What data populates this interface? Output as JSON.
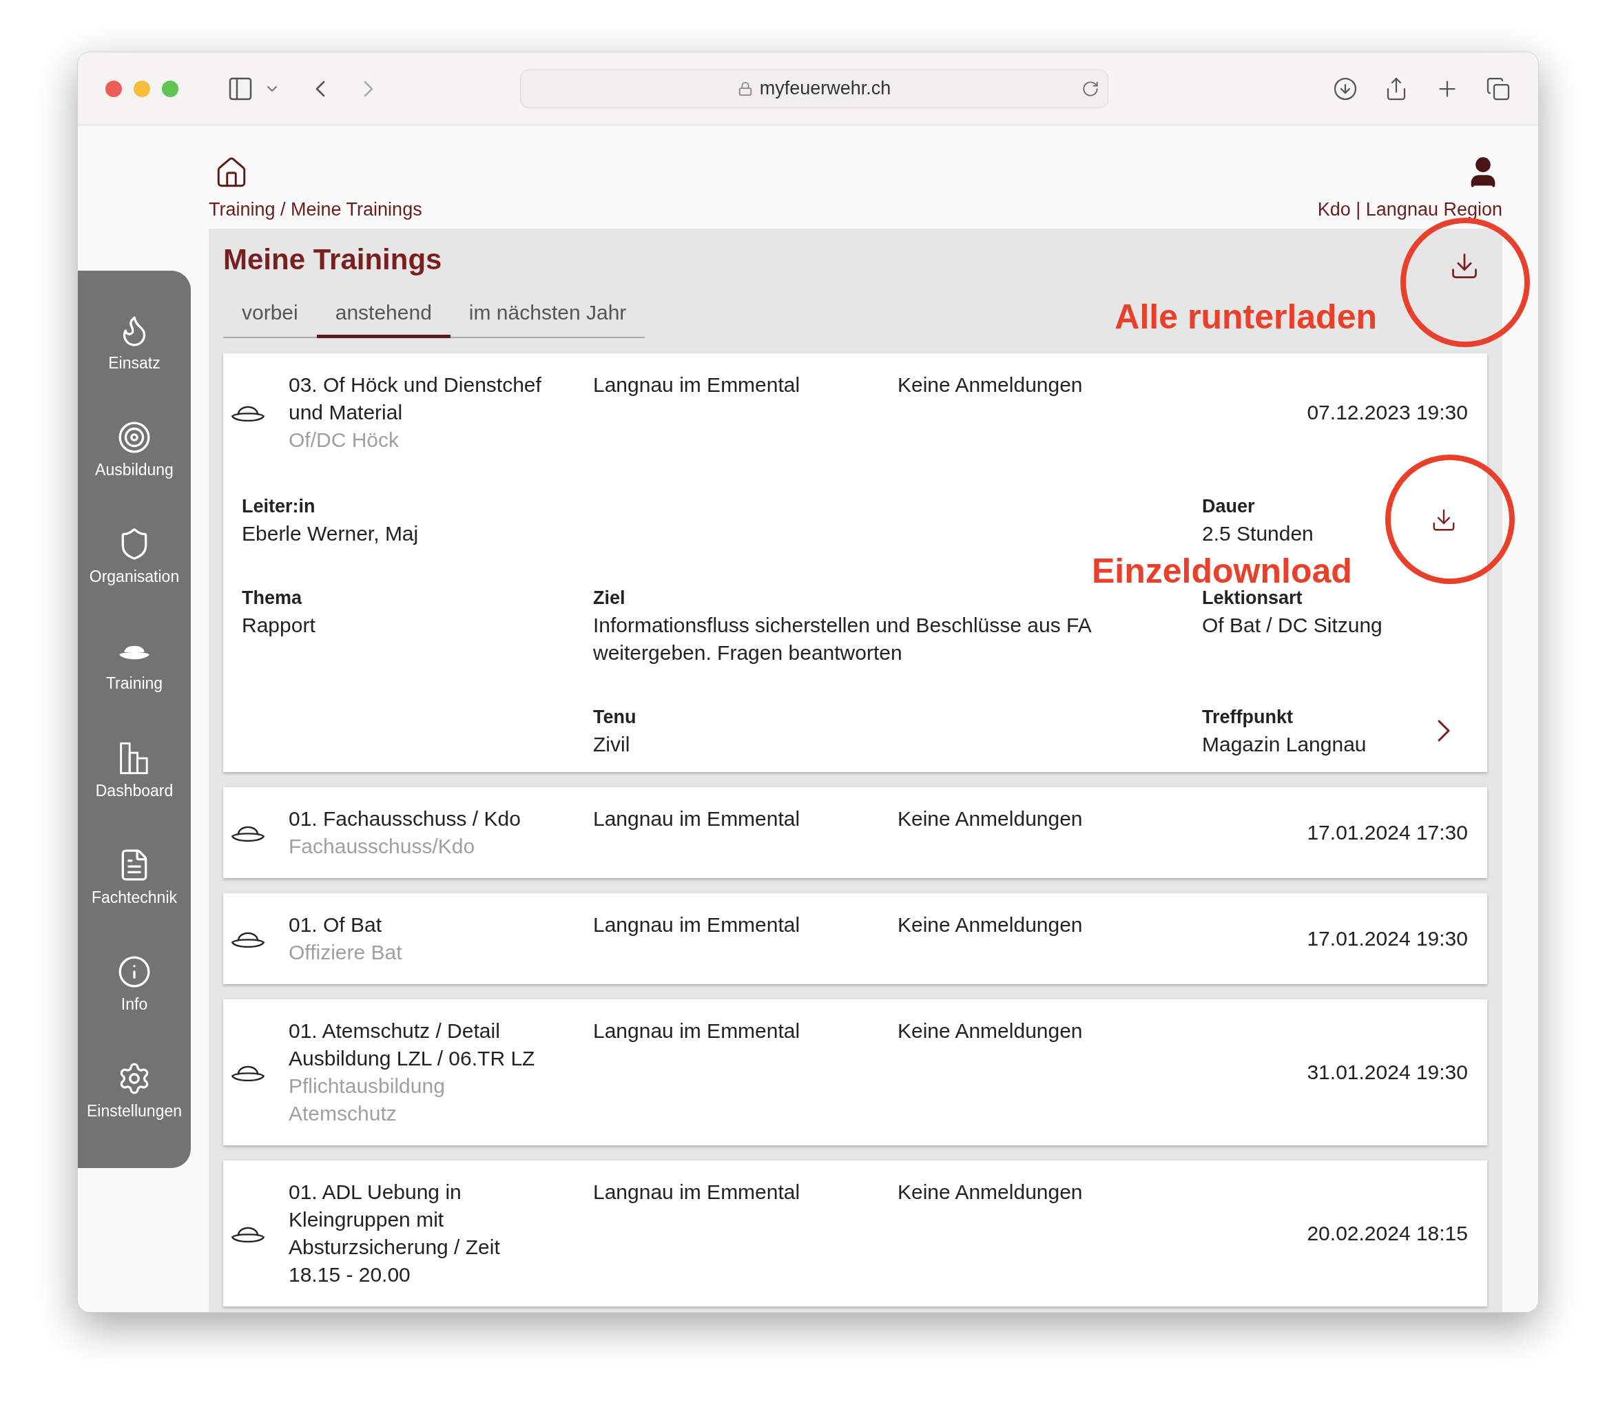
{
  "browser": {
    "url": "myfeuerwehr.ch"
  },
  "header": {
    "breadcrumb": "Training / Meine Trainings",
    "user": "Kdo | Langnau Region"
  },
  "sidebar": {
    "items": [
      {
        "label": "Einsatz"
      },
      {
        "label": "Ausbildung"
      },
      {
        "label": "Organisation"
      },
      {
        "label": "Training"
      },
      {
        "label": "Dashboard"
      },
      {
        "label": "Fachtechnik"
      },
      {
        "label": "Info"
      },
      {
        "label": "Einstellungen"
      }
    ]
  },
  "page": {
    "title": "Meine Trainings",
    "tabs": [
      {
        "label": "vorbei",
        "selected": false
      },
      {
        "label": "anstehend",
        "selected": true
      },
      {
        "label": "im nächsten Jahr",
        "selected": false
      }
    ],
    "annotations": {
      "download_all": "Alle runterladen",
      "single_download": "Einzeldownload"
    },
    "trainings": [
      {
        "title": "03. Of Höck und Dienstchef und Material",
        "subtitle": "Of/DC Höck",
        "location": "Langnau im Emmental",
        "registrations": "Keine Anmeldungen",
        "datetime": "07.12.2023 19:30",
        "details": {
          "leader_label": "Leiter:in",
          "leader": "Eberle Werner, Maj",
          "duration_label": "Dauer",
          "duration": "2.5 Stunden",
          "topic_label": "Thema",
          "topic": "Rapport",
          "goal_label": "Ziel",
          "goal": "Informationsfluss sicherstellen und Beschlüsse aus FA weitergeben. Fragen beantworten",
          "lesson_type_label": "Lektionsart",
          "lesson_type": "Of Bat / DC Sitzung",
          "dress_label": "Tenu",
          "dress": "Zivil",
          "meeting_label": "Treffpunkt",
          "meeting": "Magazin Langnau"
        }
      },
      {
        "title": "01. Fachausschuss / Kdo",
        "subtitle": "Fachausschuss/Kdo",
        "location": "Langnau im Emmental",
        "registrations": "Keine Anmeldungen",
        "datetime": "17.01.2024 17:30"
      },
      {
        "title": "01. Of Bat",
        "subtitle": "Offiziere Bat",
        "location": "Langnau im Emmental",
        "registrations": "Keine Anmeldungen",
        "datetime": "17.01.2024 19:30"
      },
      {
        "title": "01. Atemschutz / Detail Ausbildung LZL / 06.TR LZ",
        "subtitle": "Pflichtausbildung Atemschutz",
        "location": "Langnau im Emmental",
        "registrations": "Keine Anmeldungen",
        "datetime": "31.01.2024 19:30"
      },
      {
        "title": "01. ADL Uebung in Kleingruppen mit Absturzsicherung / Zeit 18.15 - 20.00",
        "location": "Langnau im Emmental",
        "registrations": "Keine Anmeldungen",
        "datetime": "20.02.2024 18:15"
      }
    ]
  }
}
